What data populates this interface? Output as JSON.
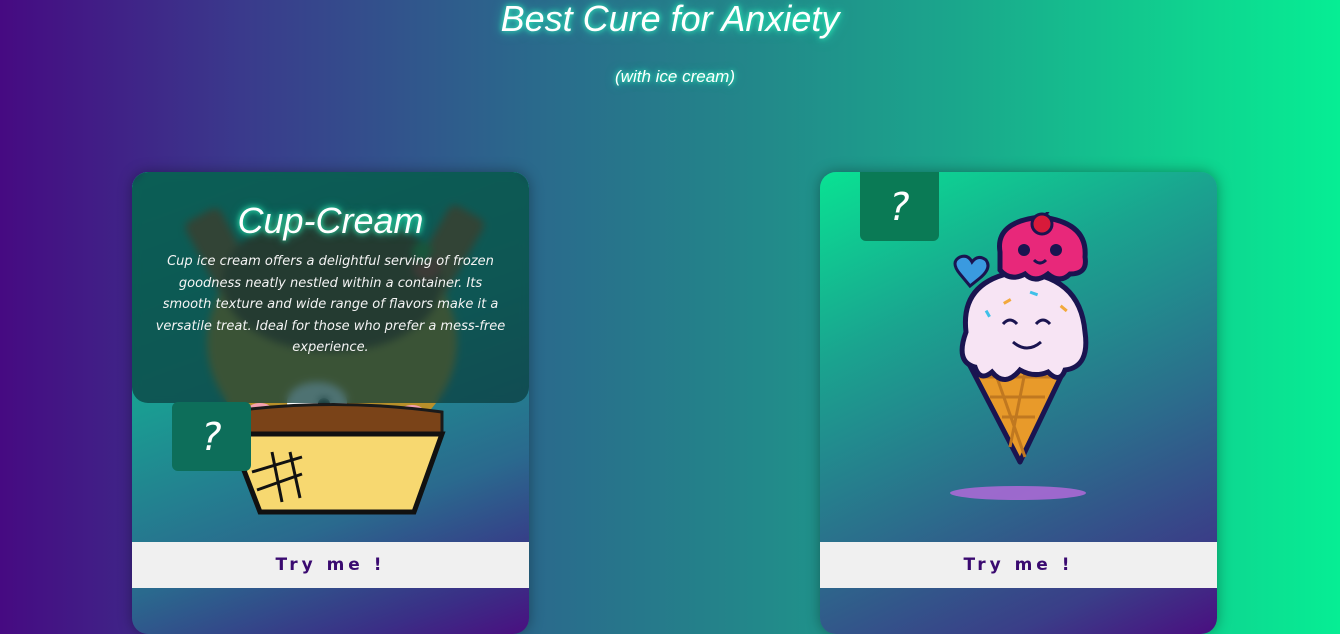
{
  "header": {
    "title": "Best Cure for Anxiety",
    "subtitle": "(with ice cream)"
  },
  "cards": [
    {
      "name": "Cup-Cream",
      "badge": "?",
      "description": "Cup ice cream offers a delightful serving of frozen goodness neatly nestled within a container. Its smooth texture and wide range of flavors make it a versatile treat. Ideal for those who prefer a mess-free experience.",
      "button_label": "Try me !",
      "illustration": "cup-ice-cream-icon"
    },
    {
      "badge": "?",
      "button_label": "Try me !",
      "illustration": "cone-ice-cream-icon"
    }
  ],
  "colors": {
    "accent_glow": "#2effc4",
    "button_text": "#3a0a70",
    "button_bg": "#f0f0f0",
    "badge_bg": "#0a7a55"
  }
}
